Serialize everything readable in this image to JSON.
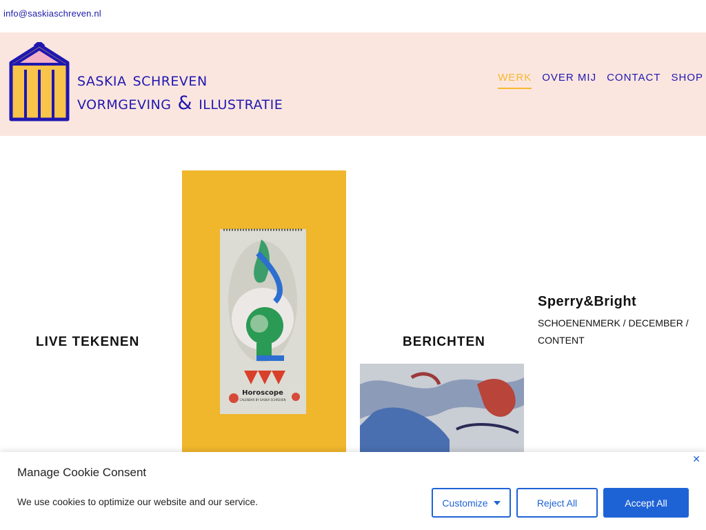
{
  "topbar": {
    "email": "info@saskiaschreven.nl"
  },
  "brand": {
    "line1": "saskia schreven",
    "line2": "vormgeving & illustratie"
  },
  "nav": {
    "werk": "WERK",
    "over_mij": "OVER MIJ",
    "contact": "CONTACT",
    "shop": "SHOP"
  },
  "cards": {
    "live_tekenen": "LIVE TEKENEN",
    "berichten": "BERICHTEN",
    "sperry_title": "Sperry&Bright",
    "sperry_subtitle": "SCHOENENMERK / DECEMBER / CONTENT"
  },
  "calendar": {
    "title": "Horoscope",
    "caption": "CALENDAR BY SASKIA SCHREVEN"
  },
  "cookie": {
    "title": "Manage Cookie Consent",
    "message": "We use cookies to optimize our website and our service.",
    "customize": "Customize",
    "reject": "Reject All",
    "accept": "Accept All"
  },
  "colors": {
    "brand_blue": "#1f17b0",
    "accent_yellow": "#f5b82e",
    "header_bg": "#fbe6df",
    "button_blue": "#1e63d6"
  }
}
